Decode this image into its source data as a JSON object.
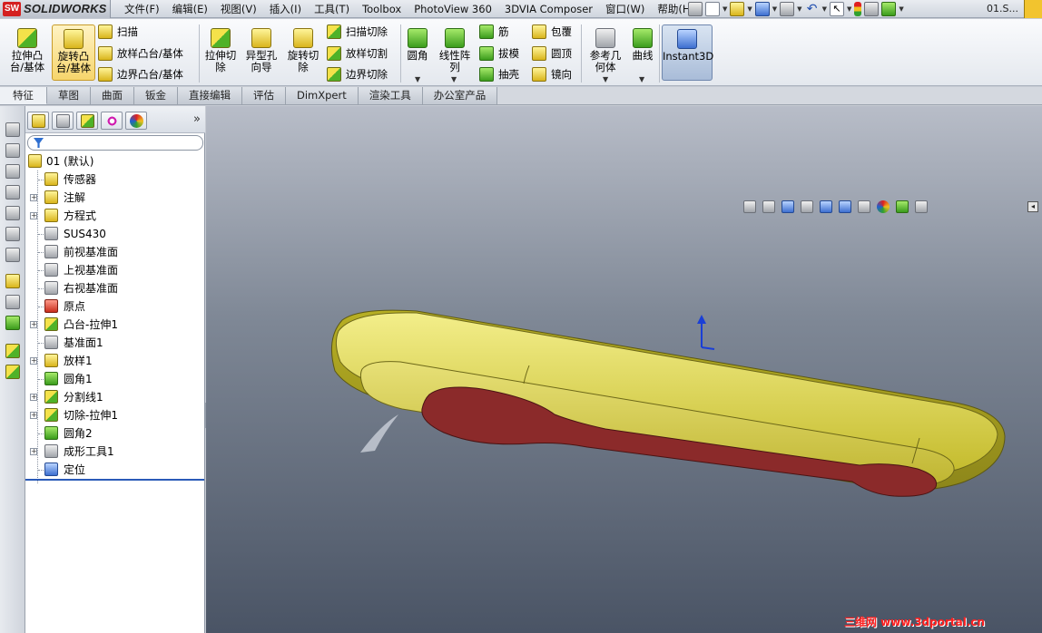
{
  "app": {
    "logo_mark": "SW",
    "brand": "SOLIDWORKS",
    "doc_title": "01.S..."
  },
  "menu": [
    "文件(F)",
    "编辑(E)",
    "视图(V)",
    "插入(I)",
    "工具(T)",
    "Toolbox",
    "PhotoView 360",
    "3DVIA Composer",
    "窗口(W)",
    "帮助(H)"
  ],
  "quick_icons": [
    "pin-icon",
    "new-document-icon",
    "open-folder-icon",
    "save-icon",
    "print-icon",
    "undo-icon",
    "select-arrow-icon",
    "traffic-light-icon",
    "file-properties-icon",
    "options-icon"
  ],
  "command_manager": {
    "extrude_boss": "拉伸凸台/基体",
    "revolve_boss": "旋转凸台/基体",
    "sweep": "扫描",
    "loft": "放样凸台/基体",
    "boundary": "边界凸台/基体",
    "extrude_cut": "拉伸切除",
    "hole_wizard": "异型孔向导",
    "revolve_cut": "旋转切除",
    "swept_cut": "扫描切除",
    "lofted_cut": "放样切割",
    "boundary_cut": "边界切除",
    "fillet": "圆角",
    "linear_pattern": "线性阵列",
    "rib": "筋",
    "draft": "拔模",
    "shell": "抽壳",
    "wrap": "包覆",
    "dome": "圆顶",
    "mirror": "镜向",
    "ref_geometry": "参考几何体",
    "curves": "曲线",
    "instant3d": "Instant3D"
  },
  "tabs": [
    "特征",
    "草图",
    "曲面",
    "钣金",
    "直接编辑",
    "评估",
    "DimXpert",
    "渲染工具",
    "办公室产品"
  ],
  "tree": {
    "root": "01  (默认)",
    "items": [
      {
        "label": "传感器",
        "icon": "sensor-icon",
        "expandable": false
      },
      {
        "label": "注解",
        "icon": "annotation-icon",
        "expandable": true
      },
      {
        "label": "方程式",
        "icon": "equation-icon",
        "expandable": true
      },
      {
        "label": "SUS430",
        "icon": "material-icon",
        "expandable": false
      },
      {
        "label": "前视基准面",
        "icon": "plane-icon",
        "expandable": false
      },
      {
        "label": "上视基准面",
        "icon": "plane-icon",
        "expandable": false
      },
      {
        "label": "右视基准面",
        "icon": "plane-icon",
        "expandable": false
      },
      {
        "label": "原点",
        "icon": "origin-icon",
        "expandable": false
      },
      {
        "label": "凸台-拉伸1",
        "icon": "extrude-boss-icon",
        "expandable": true
      },
      {
        "label": "基准面1",
        "icon": "plane-icon",
        "expandable": false
      },
      {
        "label": "放样1",
        "icon": "loft-icon",
        "expandable": true
      },
      {
        "label": "圆角1",
        "icon": "fillet-icon",
        "expandable": false
      },
      {
        "label": "分割线1",
        "icon": "split-line-icon",
        "expandable": true
      },
      {
        "label": "切除-拉伸1",
        "icon": "extrude-cut-icon",
        "expandable": true
      },
      {
        "label": "圆角2",
        "icon": "fillet-icon",
        "expandable": false
      },
      {
        "label": "成形工具1",
        "icon": "forming-tool-icon",
        "expandable": true
      },
      {
        "label": "定位",
        "icon": "position-icon",
        "expandable": false
      }
    ]
  },
  "watermark": "三维网 www.3dportal.cn",
  "colors": {
    "model_body": "#c9c234",
    "model_face": "#8b2a2a",
    "accent": "#2a5ab8"
  }
}
